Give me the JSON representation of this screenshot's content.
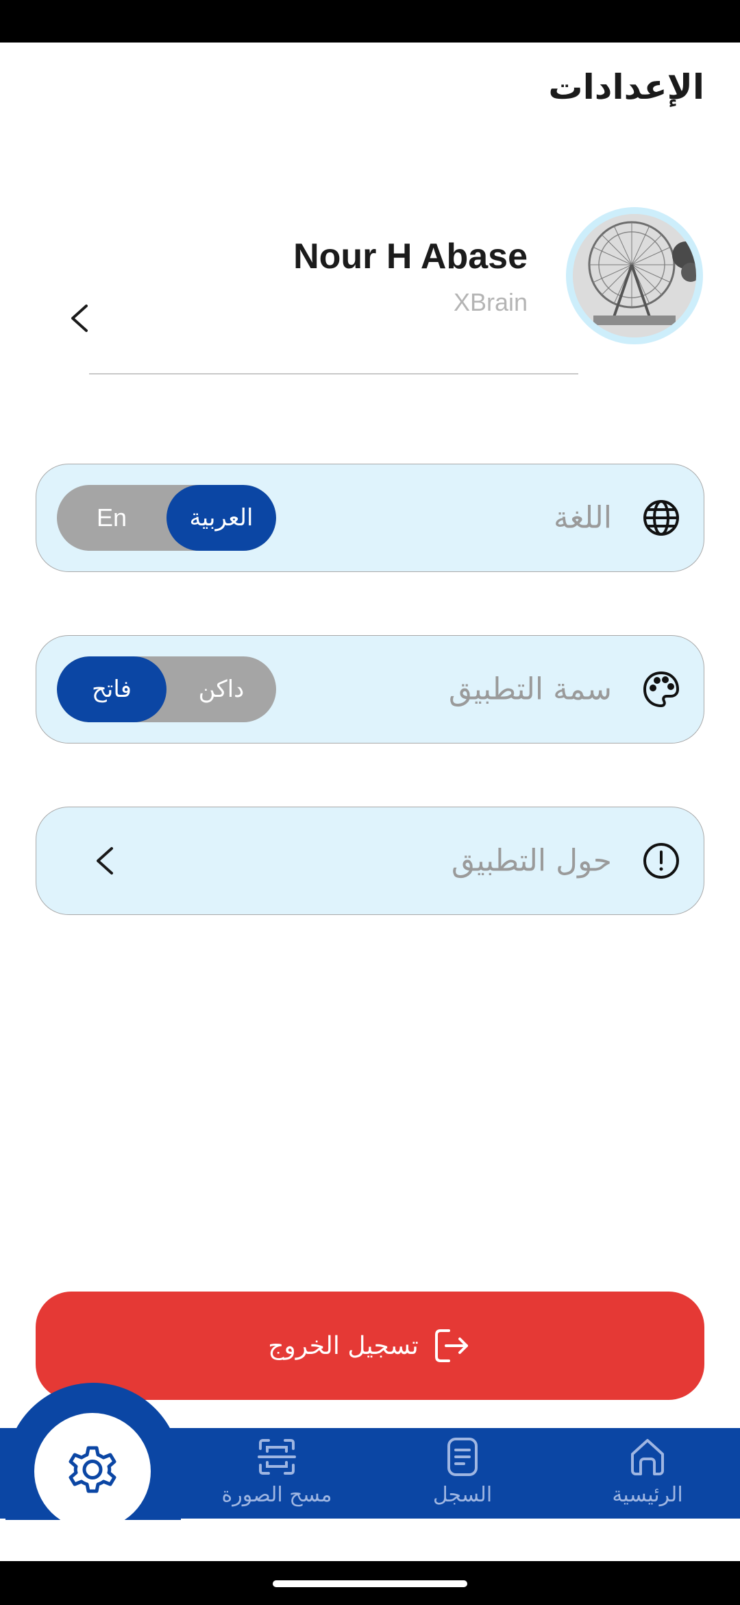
{
  "page": {
    "title": "الإعدادات"
  },
  "profile": {
    "name": "Nour H Abase",
    "company": "XBrain"
  },
  "settings": {
    "language": {
      "label": "اللغة",
      "options": [
        "En",
        "العربية"
      ],
      "selected": "العربية"
    },
    "theme": {
      "label": "سمة التطبيق",
      "options": [
        "فاتح",
        "داكن"
      ],
      "selected": "فاتح"
    },
    "about": {
      "label": "حول التطبيق"
    }
  },
  "logout": {
    "label": "تسجيل الخروج"
  },
  "nav": {
    "items": [
      {
        "label": "الرئيسية",
        "icon": "home-icon"
      },
      {
        "label": "السجل",
        "icon": "document-icon"
      },
      {
        "label": "مسح الصورة",
        "icon": "scan-icon"
      },
      {
        "label": "",
        "icon": "settings-icon",
        "active": true
      }
    ]
  },
  "colors": {
    "primary": "#0b46a4",
    "card_bg": "#dff3fc",
    "logout": "#e53935",
    "toggle_inactive": "#a5a5a5"
  }
}
